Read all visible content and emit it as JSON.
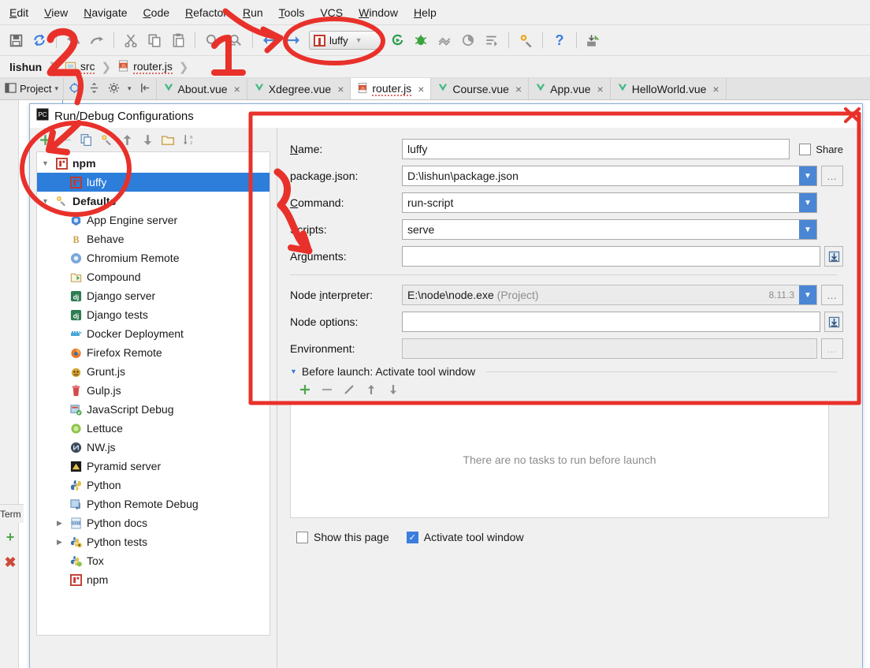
{
  "app": {
    "menubar": [
      "Edit",
      "View",
      "Navigate",
      "Code",
      "Refactor",
      "Run",
      "Tools",
      "VCS",
      "Window",
      "Help"
    ],
    "run_config_chip": "luffy",
    "toolbar_icons": [
      "save-all-icon",
      "sync-icon",
      "back-icon",
      "forward-icon",
      "cut-icon",
      "copy-icon",
      "paste-icon",
      "search-icon",
      "nav-back-icon",
      "nav-forward-icon",
      "run-icon",
      "debug-icon",
      "coverage-icon",
      "profile-icon",
      "run-with-args-icon",
      "settings-icon",
      "help-icon",
      "update-icon"
    ]
  },
  "breadcrumb": {
    "items": [
      {
        "label": "lishun",
        "icon": "none"
      },
      {
        "label": "src",
        "icon": "folder-icon"
      },
      {
        "label": "router.js",
        "icon": "js-file-icon"
      }
    ]
  },
  "toolwindow": {
    "project_label": "Project",
    "terminal_label": "Term"
  },
  "tabs": [
    {
      "label": "About.vue",
      "icon": "vue-icon",
      "active": false
    },
    {
      "label": "Xdegree.vue",
      "icon": "vue-icon",
      "active": false
    },
    {
      "label": "router.js",
      "icon": "js-file-icon",
      "active": true
    },
    {
      "label": "Course.vue",
      "icon": "vue-icon",
      "active": false
    },
    {
      "label": "App.vue",
      "icon": "vue-icon",
      "active": false
    },
    {
      "label": "HelloWorld.vue",
      "icon": "vue-icon",
      "active": false
    }
  ],
  "dialog": {
    "title": "Run/Debug Configurations",
    "close_label": "×",
    "left_toolbar": [
      {
        "name": "add-configuration-button",
        "glyph": "+"
      },
      {
        "name": "copy-configuration-button",
        "glyph": "❐"
      },
      {
        "name": "edit-templates-button",
        "glyph": "⚒"
      },
      {
        "name": "move-up-button",
        "glyph": "↑"
      },
      {
        "name": "move-down-button",
        "glyph": "↓"
      },
      {
        "name": "new-folder-button",
        "glyph": "▭"
      },
      {
        "name": "sort-configurations-button",
        "glyph": "↧"
      }
    ],
    "tree": [
      {
        "label": "npm",
        "icon": "npm-icon",
        "level": 0,
        "expandable": true,
        "expanded": true,
        "bold": true,
        "selected": false
      },
      {
        "label": "luffy",
        "icon": "npm-icon",
        "level": 1,
        "expandable": false,
        "expanded": false,
        "bold": false,
        "selected": true
      },
      {
        "label": "Defaults",
        "icon": "defaults-icon",
        "level": 0,
        "expandable": true,
        "expanded": true,
        "bold": true,
        "selected": false
      },
      {
        "label": "App Engine server",
        "icon": "app-engine-icon",
        "level": 1,
        "expandable": false,
        "expanded": false,
        "bold": false,
        "selected": false
      },
      {
        "label": "Behave",
        "icon": "behave-icon",
        "level": 1,
        "expandable": false,
        "expanded": false,
        "bold": false,
        "selected": false
      },
      {
        "label": "Chromium Remote",
        "icon": "chromium-icon",
        "level": 1,
        "expandable": false,
        "expanded": false,
        "bold": false,
        "selected": false
      },
      {
        "label": "Compound",
        "icon": "compound-icon",
        "level": 1,
        "expandable": false,
        "expanded": false,
        "bold": false,
        "selected": false
      },
      {
        "label": "Django server",
        "icon": "django-icon",
        "level": 1,
        "expandable": false,
        "expanded": false,
        "bold": false,
        "selected": false
      },
      {
        "label": "Django tests",
        "icon": "django-icon",
        "level": 1,
        "expandable": false,
        "expanded": false,
        "bold": false,
        "selected": false
      },
      {
        "label": "Docker Deployment",
        "icon": "docker-icon",
        "level": 1,
        "expandable": false,
        "expanded": false,
        "bold": false,
        "selected": false
      },
      {
        "label": "Firefox Remote",
        "icon": "firefox-icon",
        "level": 1,
        "expandable": false,
        "expanded": false,
        "bold": false,
        "selected": false
      },
      {
        "label": "Grunt.js",
        "icon": "grunt-icon",
        "level": 1,
        "expandable": false,
        "expanded": false,
        "bold": false,
        "selected": false
      },
      {
        "label": "Gulp.js",
        "icon": "gulp-icon",
        "level": 1,
        "expandable": false,
        "expanded": false,
        "bold": false,
        "selected": false
      },
      {
        "label": "JavaScript Debug",
        "icon": "javascript-debug-icon",
        "level": 1,
        "expandable": false,
        "expanded": false,
        "bold": false,
        "selected": false
      },
      {
        "label": "Lettuce",
        "icon": "lettuce-icon",
        "level": 1,
        "expandable": false,
        "expanded": false,
        "bold": false,
        "selected": false
      },
      {
        "label": "NW.js",
        "icon": "nwjs-icon",
        "level": 1,
        "expandable": false,
        "expanded": false,
        "bold": false,
        "selected": false
      },
      {
        "label": "Pyramid server",
        "icon": "pyramid-icon",
        "level": 1,
        "expandable": false,
        "expanded": false,
        "bold": false,
        "selected": false
      },
      {
        "label": "Python",
        "icon": "python-icon",
        "level": 1,
        "expandable": false,
        "expanded": false,
        "bold": false,
        "selected": false
      },
      {
        "label": "Python Remote Debug",
        "icon": "python-remote-debug-icon",
        "level": 1,
        "expandable": false,
        "expanded": false,
        "bold": false,
        "selected": false
      },
      {
        "label": "Python docs",
        "icon": "rst-icon",
        "level": 1,
        "expandable": true,
        "expanded": false,
        "bold": false,
        "selected": false
      },
      {
        "label": "Python tests",
        "icon": "python-tests-icon",
        "level": 1,
        "expandable": true,
        "expanded": false,
        "bold": false,
        "selected": false
      },
      {
        "label": "Tox",
        "icon": "tox-icon",
        "level": 1,
        "expandable": false,
        "expanded": false,
        "bold": false,
        "selected": false
      },
      {
        "label": "npm",
        "icon": "npm-icon",
        "level": 1,
        "expandable": false,
        "expanded": false,
        "bold": false,
        "selected": false
      }
    ],
    "form": {
      "name_label": "Name:",
      "name_value": "luffy",
      "share_label": "Share",
      "share_checked": false,
      "package_label": "package.json:",
      "package_value": "D:\\lishun\\package.json",
      "command_label": "Command:",
      "command_value": "run-script",
      "scripts_label": "Scripts:",
      "scripts_value": "serve",
      "arguments_label": "Arguments:",
      "arguments_value": "",
      "node_interpreter_label": "Node interpreter:",
      "node_interpreter_value": "E:\\node\\node.exe",
      "node_interpreter_suffix": "(Project)",
      "node_interpreter_version": "8.11.3",
      "node_options_label": "Node options:",
      "node_options_value": "",
      "environment_label": "Environment:",
      "environment_value": "",
      "browse_glyph": "…"
    },
    "before_launch": {
      "title": "Before launch: Activate tool window",
      "toolbar": [
        {
          "name": "add-task-button",
          "glyph": "+"
        },
        {
          "name": "remove-task-button",
          "glyph": "−"
        },
        {
          "name": "edit-task-button",
          "glyph": "╱"
        },
        {
          "name": "move-task-up-button",
          "glyph": "↑"
        },
        {
          "name": "move-task-down-button",
          "glyph": "↓"
        }
      ],
      "empty_text": "There are no tasks to run before launch",
      "show_page_label": "Show this page",
      "show_page_checked": false,
      "activate_tool_window_label": "Activate tool window",
      "activate_tool_window_checked": true
    }
  },
  "annotations": {
    "marker_one": "1",
    "marker_two": "2",
    "accent_color": "#e8312a"
  }
}
